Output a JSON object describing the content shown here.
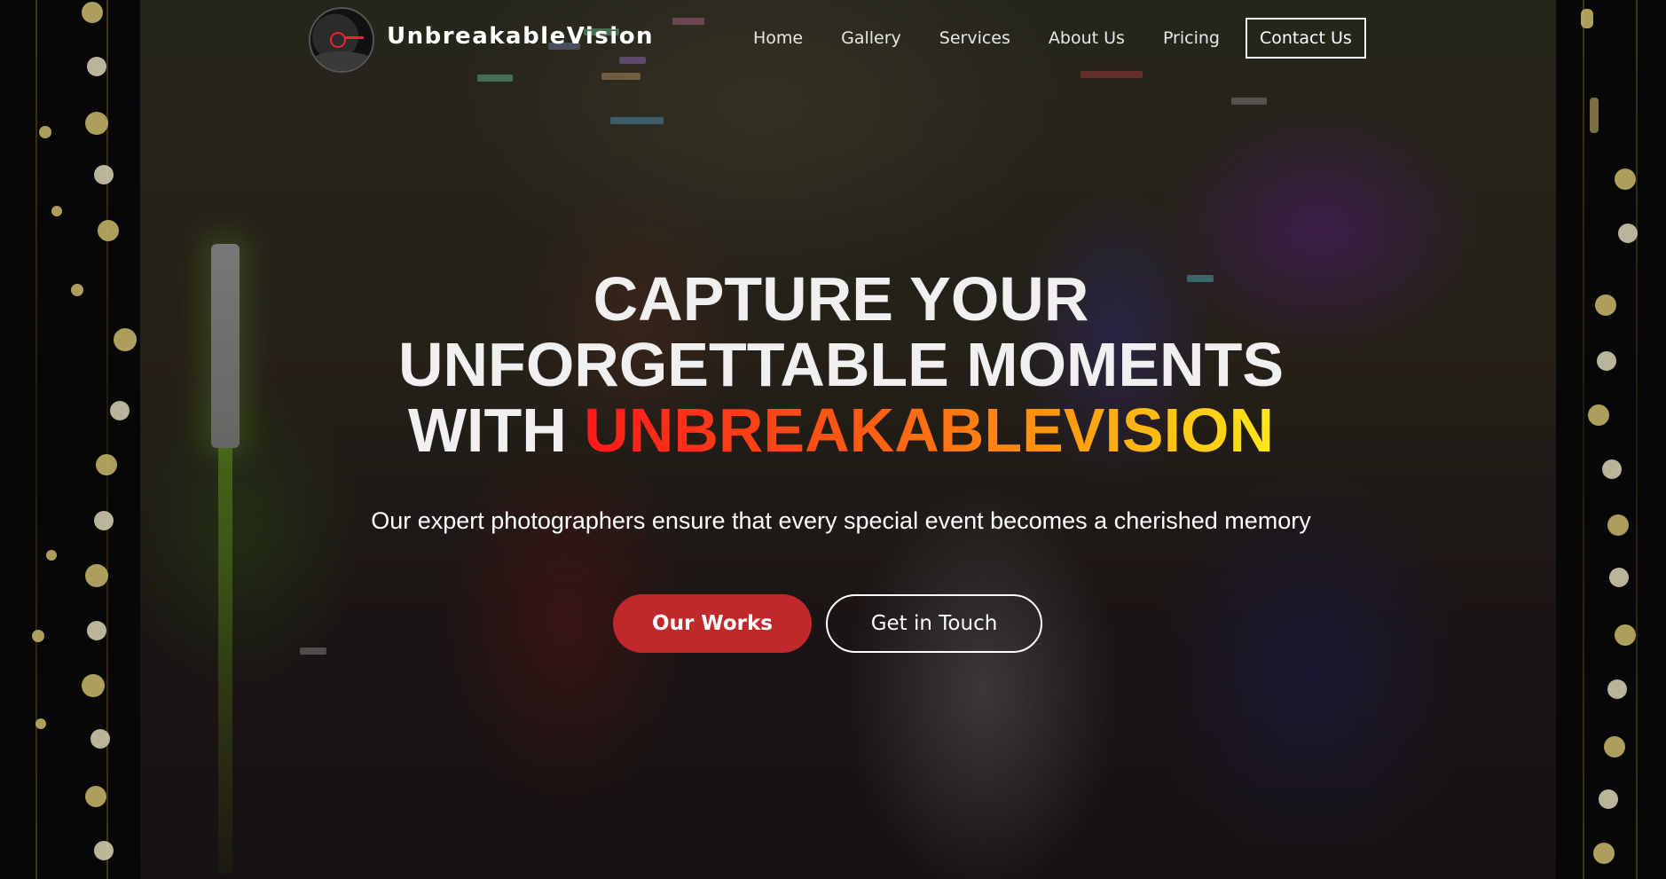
{
  "brand": {
    "name": "UnbreakableVision",
    "logo_icon": "photographer-avatar-icon"
  },
  "nav": {
    "items": [
      {
        "label": "Home"
      },
      {
        "label": "Gallery"
      },
      {
        "label": "Services"
      },
      {
        "label": "About Us"
      },
      {
        "label": "Pricing"
      }
    ],
    "contact_label": "Contact Us"
  },
  "hero": {
    "headline_line1": "CAPTURE YOUR",
    "headline_line2": "UNFORGETTABLE MOMENTS",
    "headline_line3_prefix": "WITH",
    "headline_highlight": "UNBREAKABLEVISION",
    "subheadline": "Our expert photographers ensure that every special event becomes a cherished memory",
    "primary_button": "Our Works",
    "secondary_button": "Get in Touch"
  },
  "colors": {
    "primary_button": "#c0282c",
    "highlight_gradient_start": "#ff1a1a",
    "highlight_gradient_end": "#ffe81a",
    "page_background": "#060606"
  }
}
